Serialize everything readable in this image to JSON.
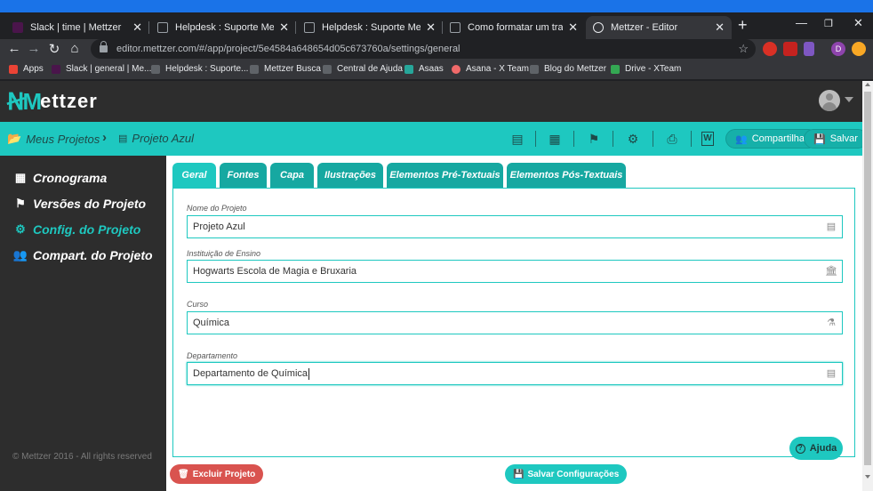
{
  "browser": {
    "tabs": [
      {
        "title": "Slack | time | Mettzer",
        "active": false
      },
      {
        "title": "Helpdesk : Suporte Mettzer",
        "active": false
      },
      {
        "title": "Helpdesk : Suporte Mettzer",
        "active": false
      },
      {
        "title": "Como formatar um trabalho p",
        "active": false
      },
      {
        "title": "Mettzer - Editor",
        "active": true
      }
    ],
    "url": "editor.mettzer.com/#/app/project/5e4584a648654d05c673760a/settings/general",
    "bookmarks": [
      "Apps",
      "Slack | general | Me...",
      "Helpdesk : Suporte...",
      "Mettzer Busca",
      "Central de Ajuda",
      "Asaas",
      "Asana - X Team",
      "Blog do Mettzer",
      "Drive - XTeam"
    ],
    "profile_initial": "D"
  },
  "app": {
    "logo_text": "ettzer",
    "accent_color": "#1ec8c0"
  },
  "projectbar": {
    "breadcrumb_root": "Meus Projetos",
    "breadcrumb_current": "Projeto Azul",
    "share_label": "Compartilhar",
    "save_label": "Salvar"
  },
  "sidebar": {
    "items": [
      {
        "label": "Cronograma",
        "icon": "calendar-icon",
        "active": false
      },
      {
        "label": "Versões do Projeto",
        "icon": "flag-icon",
        "active": false
      },
      {
        "label": "Config. do Projeto",
        "icon": "gears-icon",
        "active": true
      },
      {
        "label": "Compart. do Projeto",
        "icon": "users-icon",
        "active": false
      }
    ],
    "copyright": "© Mettzer 2016 - All rights reserved"
  },
  "settings": {
    "tabs": [
      "Geral",
      "Fontes",
      "Capa",
      "Ilustrações",
      "Elementos Pré-Textuais",
      "Elementos Pós-Textuais"
    ],
    "active_tab": "Geral",
    "fields": {
      "project_name": {
        "label": "Nome do Projeto",
        "value": "Projeto Azul"
      },
      "institution": {
        "label": "Instituição de Ensino",
        "value": "Hogwarts Escola de Magia e Bruxaria"
      },
      "course": {
        "label": "Curso",
        "value": "Química"
      },
      "department": {
        "label": "Departamento",
        "value": "Departamento de Química"
      }
    },
    "help_label": "Ajuda",
    "delete_label": "Excluir Projeto",
    "save_settings_label": "Salvar Configurações"
  }
}
